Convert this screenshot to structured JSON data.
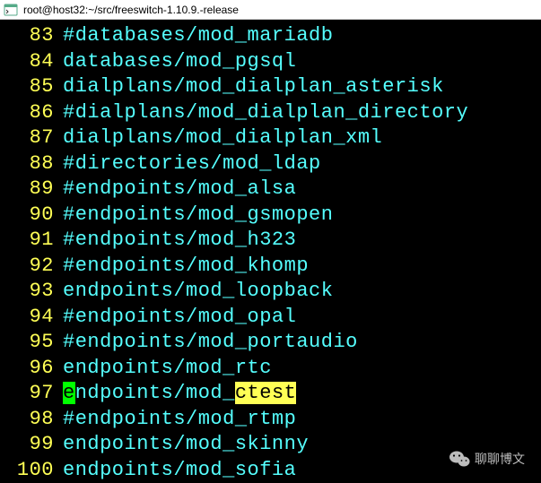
{
  "title": "root@host32:~/src/freeswitch-1.10.9.-release",
  "lines": [
    {
      "no": "83",
      "text": "#databases/mod_mariadb"
    },
    {
      "no": "84",
      "text": "databases/mod_pgsql"
    },
    {
      "no": "85",
      "text": "dialplans/mod_dialplan_asterisk"
    },
    {
      "no": "86",
      "text": "#dialplans/mod_dialplan_directory"
    },
    {
      "no": "87",
      "text": "dialplans/mod_dialplan_xml"
    },
    {
      "no": "88",
      "text": "#directories/mod_ldap"
    },
    {
      "no": "89",
      "text": "#endpoints/mod_alsa"
    },
    {
      "no": "90",
      "text": "#endpoints/mod_gsmopen"
    },
    {
      "no": "91",
      "text": "#endpoints/mod_h323"
    },
    {
      "no": "92",
      "text": "#endpoints/mod_khomp"
    },
    {
      "no": "93",
      "text": "endpoints/mod_loopback"
    },
    {
      "no": "94",
      "text": "#endpoints/mod_opal"
    },
    {
      "no": "95",
      "text": "#endpoints/mod_portaudio"
    },
    {
      "no": "96",
      "text": "endpoints/mod_rtc"
    },
    {
      "no": "97",
      "cursor": "e",
      "pre": "ndpoints/mod_",
      "hl": "ctest"
    },
    {
      "no": "98",
      "text": "#endpoints/mod_rtmp"
    },
    {
      "no": "99",
      "text": "endpoints/mod_skinny"
    },
    {
      "no": "100",
      "text": "endpoints/mod_sofia"
    }
  ],
  "watermark": "聊聊博文"
}
